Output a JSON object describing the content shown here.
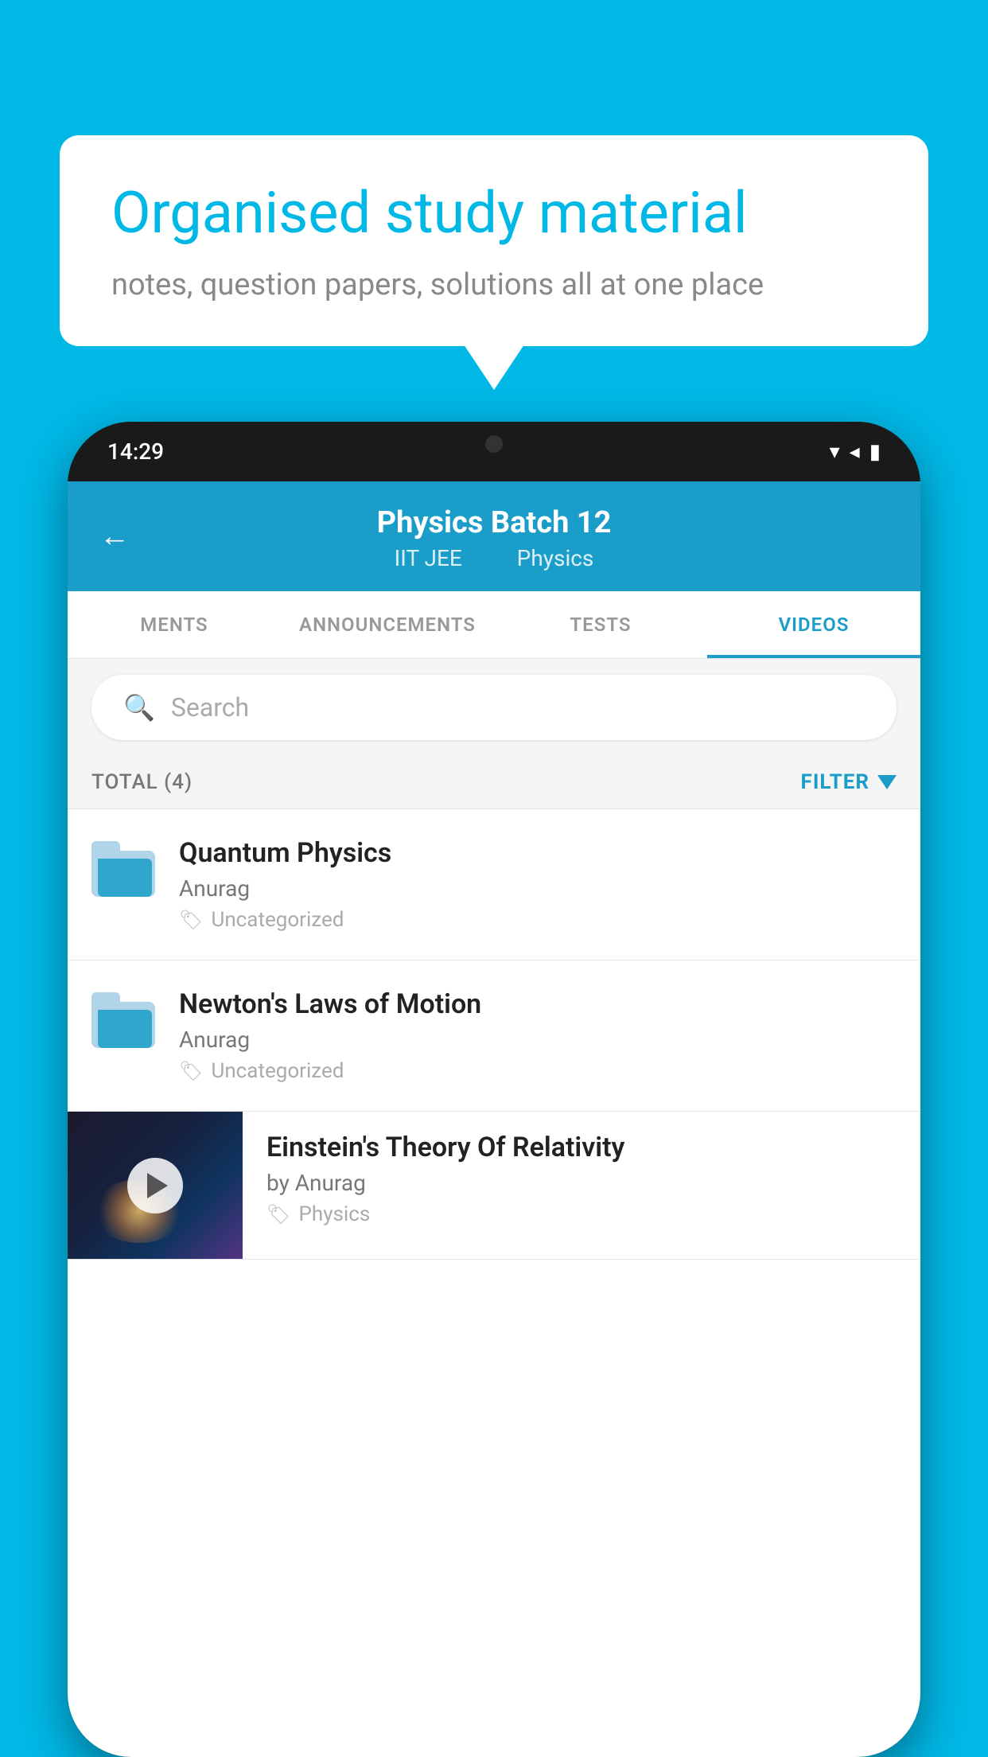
{
  "background_color": "#00b8e6",
  "speech_bubble": {
    "title": "Organised study material",
    "subtitle": "notes, question papers, solutions all at one place"
  },
  "status_bar": {
    "time": "14:29",
    "wifi": "▾",
    "signal": "◂",
    "battery": "▮"
  },
  "header": {
    "back_label": "←",
    "title": "Physics Batch 12",
    "subtitle_part1": "IIT JEE",
    "subtitle_part2": "Physics"
  },
  "tabs": [
    {
      "label": "MENTS",
      "active": false
    },
    {
      "label": "ANNOUNCEMENTS",
      "active": false
    },
    {
      "label": "TESTS",
      "active": false
    },
    {
      "label": "VIDEOS",
      "active": true
    }
  ],
  "search": {
    "placeholder": "Search"
  },
  "filter": {
    "total_label": "TOTAL (4)",
    "filter_label": "FILTER"
  },
  "list_items": [
    {
      "title": "Quantum Physics",
      "author": "Anurag",
      "tag": "Uncategorized",
      "type": "folder"
    },
    {
      "title": "Newton's Laws of Motion",
      "author": "Anurag",
      "tag": "Uncategorized",
      "type": "folder"
    },
    {
      "title": "Einstein's Theory Of Relativity",
      "author": "by Anurag",
      "tag": "Physics",
      "type": "video"
    }
  ]
}
